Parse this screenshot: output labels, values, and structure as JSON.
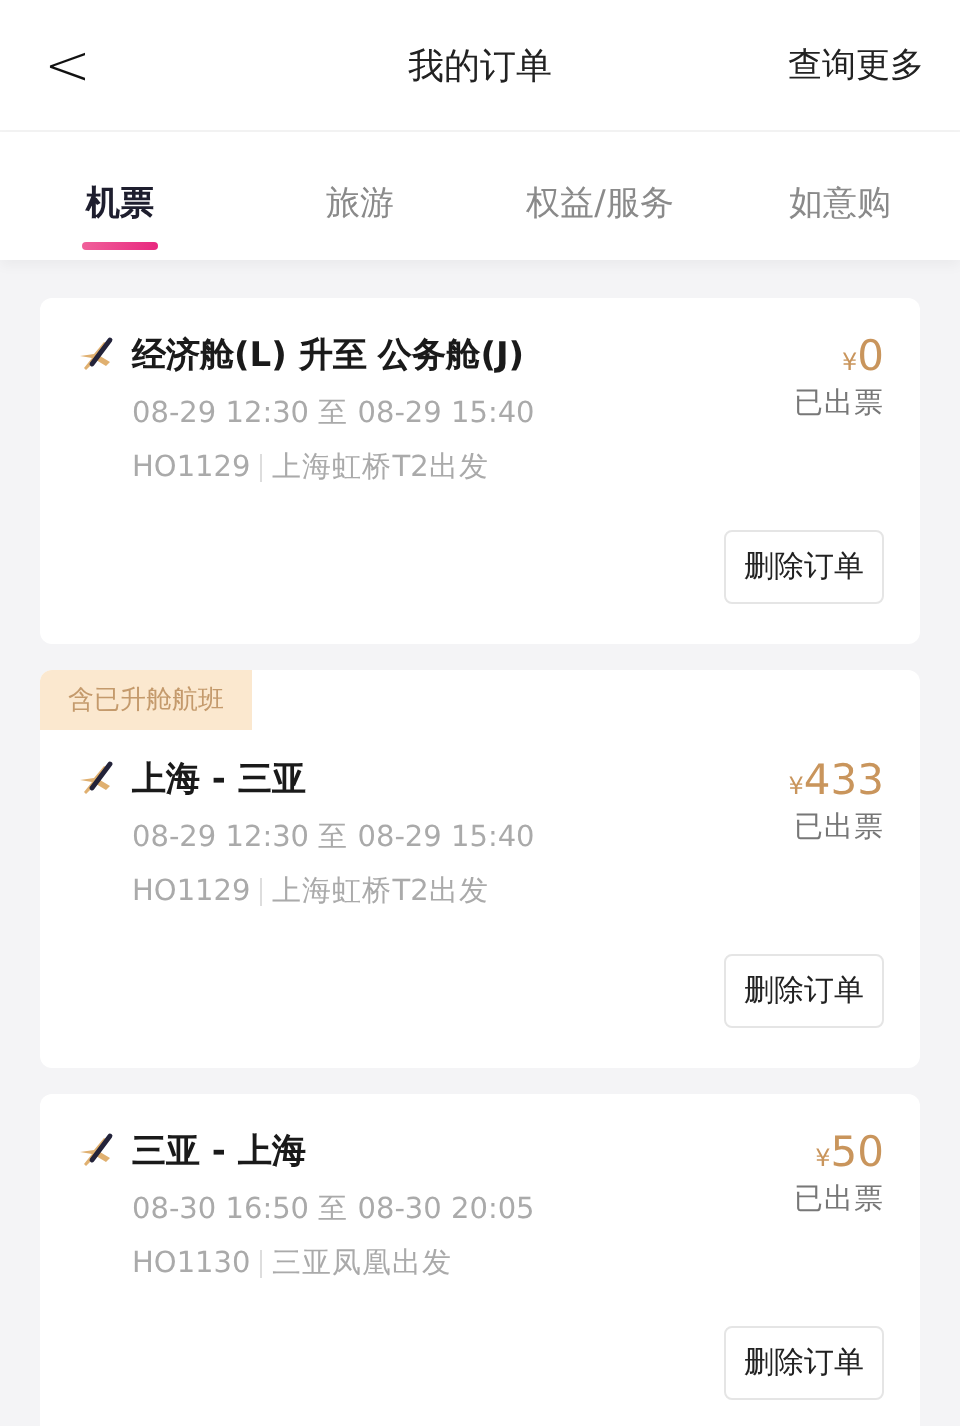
{
  "header": {
    "back": "<",
    "title": "我的订单",
    "action": "查询更多"
  },
  "tabs": [
    {
      "label": "机票",
      "selected": true
    },
    {
      "label": "旅游",
      "selected": false
    },
    {
      "label": "权益/服务",
      "selected": false
    },
    {
      "label": "如意购",
      "selected": false
    }
  ],
  "orders": [
    {
      "title": "经济舱(L) 升至 公务舱(J)",
      "currency": "¥",
      "price": "0",
      "status": "已出票",
      "time": "08-29 12:30 至 08-29 15:40",
      "flight": "HO1129",
      "departure": "上海虹桥T2出发",
      "button": "删除订单"
    },
    {
      "tag": "含已升舱航班",
      "title": "上海 - 三亚",
      "currency": "¥",
      "price": "433",
      "status": "已出票",
      "time": "08-29 12:30 至 08-29 15:40",
      "flight": "HO1129",
      "departure": "上海虹桥T2出发",
      "button": "删除订单"
    },
    {
      "title": "三亚 - 上海",
      "currency": "¥",
      "price": "50",
      "status": "已出票",
      "time": "08-30 16:50 至 08-30 20:05",
      "flight": "HO1130",
      "departure": "三亚凤凰出发",
      "button": "删除订单"
    }
  ]
}
